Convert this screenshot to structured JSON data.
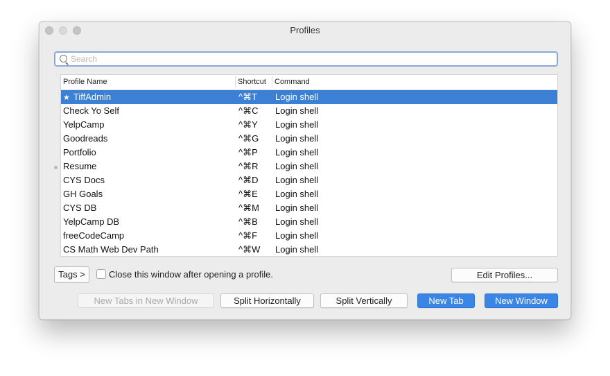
{
  "window": {
    "title": "Profiles"
  },
  "search": {
    "placeholder": "Search"
  },
  "table": {
    "headers": {
      "name": "Profile Name",
      "shortcut": "Shortcut",
      "command": "Command"
    },
    "rows": [
      {
        "name": "TiffAdmin",
        "shortcut": "^⌘T",
        "command": "Login shell",
        "default": true,
        "selected": true
      },
      {
        "name": "Check Yo Self",
        "shortcut": "^⌘C",
        "command": "Login shell"
      },
      {
        "name": "YelpCamp",
        "shortcut": "^⌘Y",
        "command": "Login shell"
      },
      {
        "name": "Goodreads",
        "shortcut": "^⌘G",
        "command": "Login shell"
      },
      {
        "name": "Portfolio",
        "shortcut": "^⌘P",
        "command": "Login shell"
      },
      {
        "name": "Resume",
        "shortcut": "^⌘R",
        "command": "Login shell"
      },
      {
        "name": "CYS Docs",
        "shortcut": "^⌘D",
        "command": "Login shell"
      },
      {
        "name": "GH Goals",
        "shortcut": "^⌘E",
        "command": "Login shell"
      },
      {
        "name": "CYS DB",
        "shortcut": "^⌘M",
        "command": "Login shell"
      },
      {
        "name": "YelpCamp DB",
        "shortcut": "^⌘B",
        "command": "Login shell"
      },
      {
        "name": "freeCodeCamp",
        "shortcut": "^⌘F",
        "command": "Login shell"
      },
      {
        "name": "CS Math Web Dev Path",
        "shortcut": "^⌘W",
        "command": "Login shell"
      }
    ]
  },
  "options": {
    "tags_button": "Tags >",
    "close_after_open_label": "Close this window after opening a profile.",
    "close_after_open_checked": false,
    "edit_profiles_button": "Edit Profiles..."
  },
  "actions": {
    "new_tabs_in_new_window": "New Tabs in New Window",
    "split_horizontally": "Split Horizontally",
    "split_vertically": "Split Vertically",
    "new_tab": "New Tab",
    "new_window": "New Window"
  },
  "colors": {
    "selection": "#3b80d5",
    "primary_button": "#3b86e4",
    "search_focus": "#8aa9d8"
  }
}
